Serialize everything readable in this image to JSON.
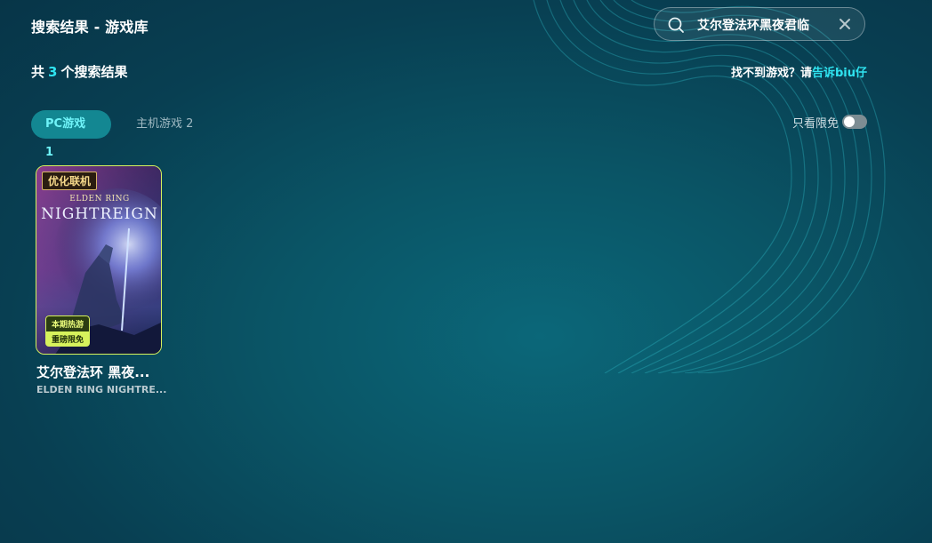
{
  "header": {
    "title": "搜索结果 - 游戏库"
  },
  "search": {
    "value": "艾尔登法环黑夜君临"
  },
  "results": {
    "prefix": "共",
    "count": "3",
    "suffix": "个搜索结果",
    "help_prefix": "找不到游戏？请",
    "help_link": "告诉biu仔"
  },
  "tabs": [
    {
      "label": "PC游戏 1",
      "active": true
    },
    {
      "label": "主机游戏 2",
      "active": false
    }
  ],
  "filter": {
    "free_only_label": "只看限免",
    "free_only_on": false
  },
  "games": [
    {
      "name": "艾尔登法环 黑夜...",
      "subtitle": "ELDEN RING NIGHTRE...",
      "badge_top": "优化联机",
      "cover_line1": "ELDEN RING",
      "cover_line2": "NIGHTREIGN",
      "tag_hot": "本期热游",
      "tag_free": "重磅限免"
    }
  ],
  "colors": {
    "accent": "#2fe3f0",
    "card_border": "#d7f25c",
    "tab_active_bg": "#138792"
  },
  "icons": {
    "search": "search-icon",
    "clear": "close-icon"
  }
}
